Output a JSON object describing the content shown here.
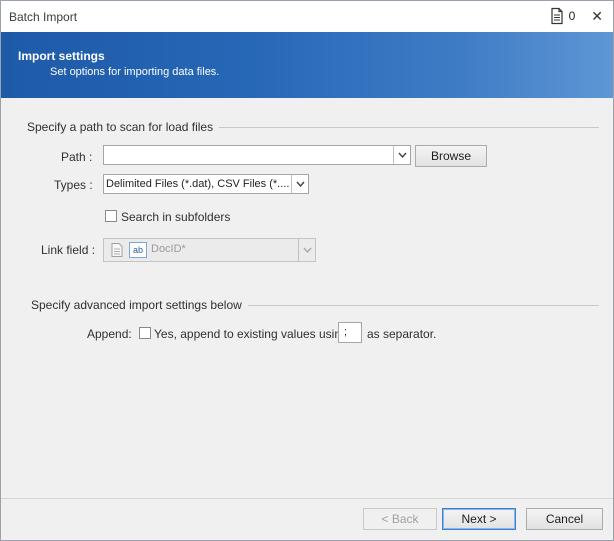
{
  "window": {
    "title": "Batch Import",
    "count": "0",
    "close": "✕"
  },
  "banner": {
    "title": "Import settings",
    "subtitle": "Set options for importing data files."
  },
  "scan": {
    "heading": "Specify a path to scan for load files",
    "path_label": "Path :",
    "path_value": "",
    "browse_label": "Browse",
    "types_label": "Types :",
    "types_value": "Delimited Files (*.dat), CSV Files (*....",
    "subfolders_label": "Search in subfolders",
    "subfolders_checked": false,
    "link_label": "Link field :",
    "link_value": "DocID*",
    "link_icon": "ab"
  },
  "advanced": {
    "heading": "Specify advanced import settings below",
    "append_label": "Append:",
    "append_text": "Yes, append to existing values using",
    "separator_value": ";",
    "separator_suffix": "as separator.",
    "append_checked": false
  },
  "footer": {
    "back_label": "< Back",
    "next_label": "Next >",
    "cancel_label": "Cancel"
  }
}
